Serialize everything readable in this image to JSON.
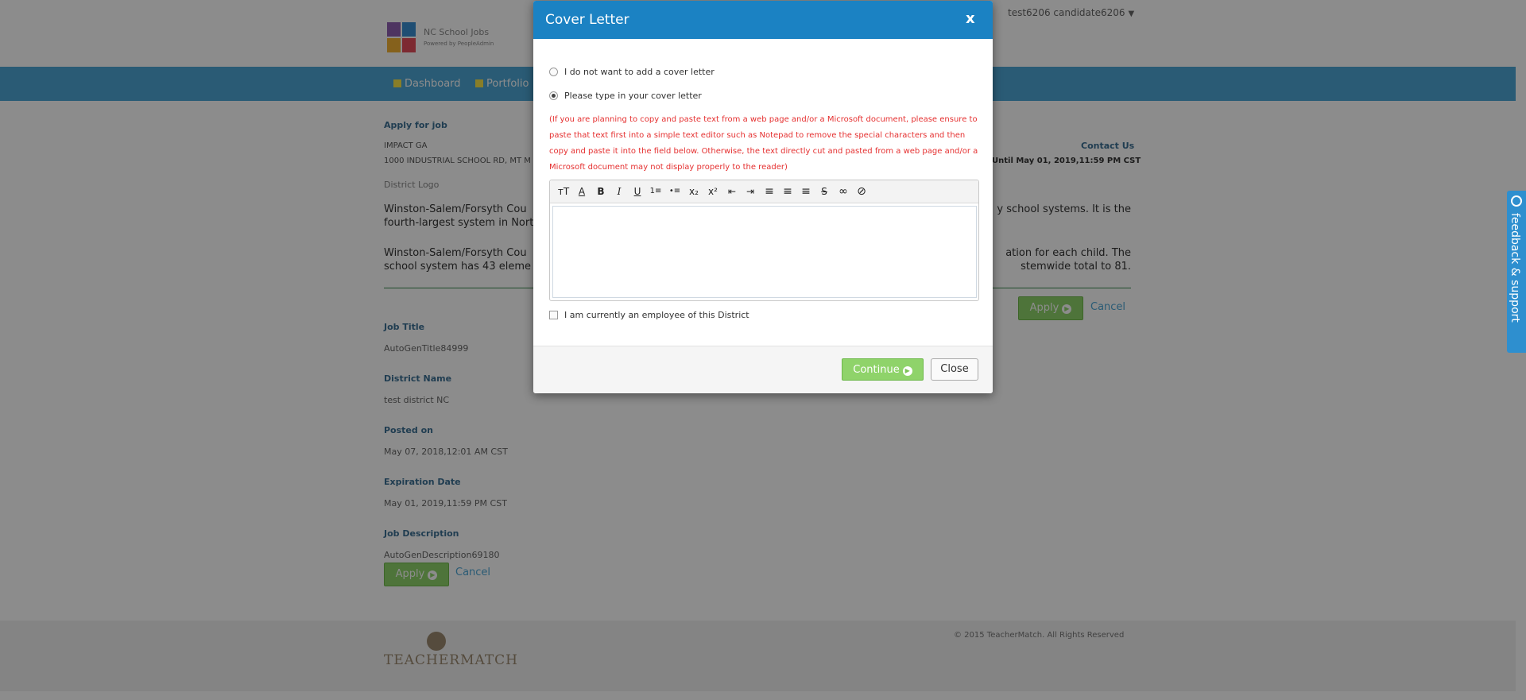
{
  "header": {
    "logo_name": "NC School Jobs",
    "logo_sub": "Powered by PeopleAdmin",
    "user_menu": "test6206 candidate6206",
    "user_caret": "▼"
  },
  "nav": {
    "items": [
      {
        "label": "Dashboard"
      },
      {
        "label": "Portfolio"
      }
    ]
  },
  "job": {
    "apply_for_job": "Apply for job",
    "school": "IMPACT GA",
    "address": "1000 INDUSTRIAL SCHOOL RD, MT M",
    "district_logo_alt": "District Logo",
    "contact_us": "Contact Us",
    "until": "Until May 01, 2019,11:59 PM CST",
    "para1_left": "Winston-Salem/Forsyth Cou",
    "para1_right": "y school systems. It is the",
    "para1_line2": "fourth-largest system in North",
    "para2_left": "Winston-Salem/Forsyth Cou",
    "para2_right": "ation for each child. The",
    "para2_line2_left": "school system has 43 eleme",
    "para2_line2_right": "stemwide total to 81.",
    "apply_label": "Apply",
    "cancel_label": "Cancel",
    "fields": [
      {
        "label": "Job Title",
        "value": "AutoGenTitle84999"
      },
      {
        "label": "District Name",
        "value": "test district NC"
      },
      {
        "label": "Posted on",
        "value": "May 07, 2018,12:01 AM CST"
      },
      {
        "label": "Expiration Date",
        "value": "May 01, 2019,11:59 PM CST"
      },
      {
        "label": "Job Description",
        "value": "AutoGenDescription69180"
      }
    ]
  },
  "footer": {
    "brand": "TEACHERMATCH",
    "copyright": "© 2015 TeacherMatch. All Rights Reserved"
  },
  "feedback": {
    "label": "feedback & support"
  },
  "modal": {
    "title": "Cover Letter",
    "close_label": "x",
    "option_no_letter": "I do not want to add a cover letter",
    "option_type_letter": "Please type in your cover letter",
    "selected_option": "option_type_letter",
    "warning": "(If you are planning to copy and paste text from a web page and/or a Microsoft document, please ensure to paste that text first into a simple text editor such as Notepad to remove the special characters and then copy and paste it into the field below. Otherwise, the text directly cut and pasted from a web page and/or a Microsoft document may not display properly to the reader)",
    "editor_value": "",
    "toolbar": {
      "font_size": "тT",
      "font_color": "A",
      "bold": "B",
      "italic": "I",
      "underline": "U",
      "ordered_list": "1≡",
      "unordered_list": "•≡",
      "subscript": "x₂",
      "superscript": "x²",
      "outdent": "⇤",
      "indent": "⇥",
      "align_left": "≡",
      "align_center": "≡",
      "align_right": "≡",
      "strikethrough": "S",
      "link": "∞",
      "unlink": "⊘"
    },
    "employee_checkbox": "I am currently an employee of this District",
    "employee_checked": false,
    "continue_label": "Continue",
    "close_button_label": "Close"
  },
  "colors": {
    "modal_header": "#1b82c3",
    "warning_text": "#e53030",
    "continue_button": "#8fd36a",
    "navbar": "#4ea7d6",
    "feedback_tab": "#2e8fcf"
  }
}
